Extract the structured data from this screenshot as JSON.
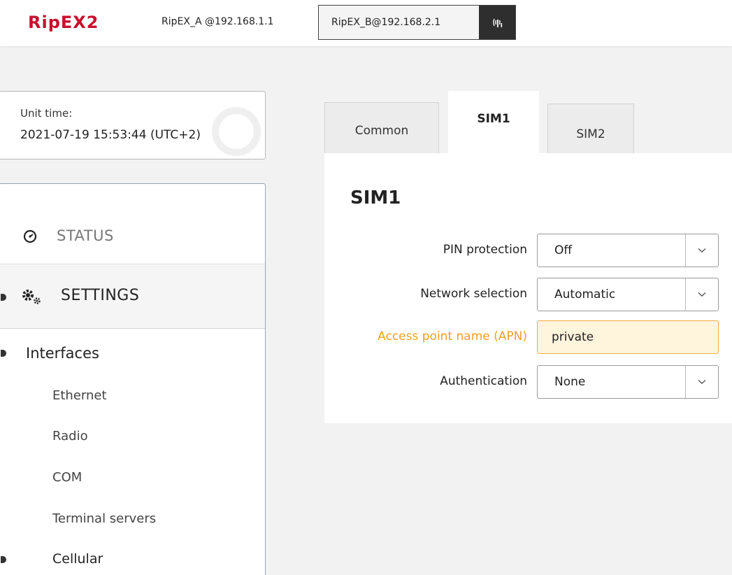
{
  "header": {
    "logo": "RipEX2",
    "unit_a": "RipEX_A @192.168.1.1",
    "unit_b": "RipEX_B@192.168.2.1",
    "unit_b_icon": "radio-signal-icon"
  },
  "unit_time": {
    "label": "Unit time:",
    "value": "2021-07-19 15:53:44 (UTC+2)"
  },
  "nav": {
    "status": "STATUS",
    "settings": "SETTINGS",
    "interfaces": "Interfaces",
    "sub_items": [
      "Ethernet",
      "Radio",
      "COM",
      "Terminal servers"
    ],
    "cellular": "Cellular"
  },
  "tabs": [
    {
      "label": "Common",
      "active": false
    },
    {
      "label": "SIM1",
      "active": true
    },
    {
      "label": "SIM2",
      "active": false
    }
  ],
  "form": {
    "title": "SIM1",
    "pin_protection": {
      "label": "PIN protection",
      "value": "Off"
    },
    "network_selection": {
      "label": "Network selection",
      "value": "Automatic"
    },
    "apn": {
      "label": "Access point name (APN)",
      "value": "private"
    },
    "authentication": {
      "label": "Authentication",
      "value": "None"
    }
  },
  "colors": {
    "brand": "#c8102e",
    "warning": "#f0a020",
    "apn_background": "#fff4dc"
  }
}
